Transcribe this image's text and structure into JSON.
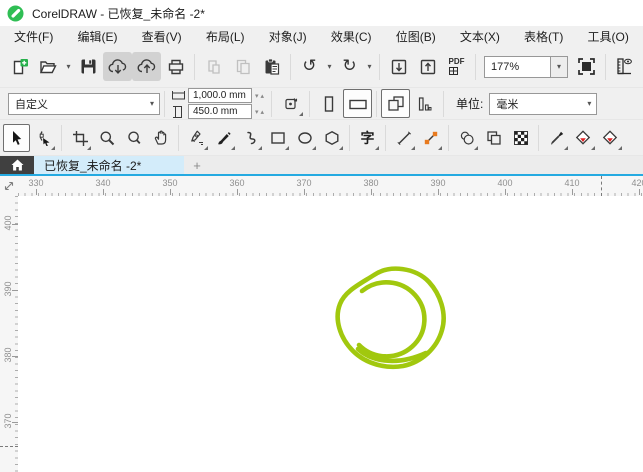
{
  "window": {
    "title": "CorelDRAW - 已恢复_未命名 -2*",
    "app_icon": "coreldraw-logo"
  },
  "menu": {
    "items": [
      {
        "label": "文件(F)"
      },
      {
        "label": "编辑(E)"
      },
      {
        "label": "查看(V)"
      },
      {
        "label": "布局(L)"
      },
      {
        "label": "对象(J)"
      },
      {
        "label": "效果(C)"
      },
      {
        "label": "位图(B)"
      },
      {
        "label": "文本(X)"
      },
      {
        "label": "表格(T)"
      },
      {
        "label": "工具(O)"
      }
    ]
  },
  "standard_toolbar": {
    "zoom_level": "177%",
    "pdf_label": "PDF",
    "icons": [
      "new-document",
      "open",
      "save",
      "cloud-download",
      "cloud-upload",
      "print",
      "cut",
      "copy",
      "paste",
      "undo",
      "redo",
      "import",
      "export",
      "publish-to-pdf",
      "zoom-level-combo",
      "full-screen-preview",
      "show-rulers"
    ],
    "disabled_icons": [
      "cut",
      "copy"
    ],
    "pressed_icons": [
      "cloud-download",
      "cloud-upload"
    ]
  },
  "property_bar": {
    "page_size_preset": "自定义",
    "page_width": "1,000.0 mm",
    "page_height": "450.0 mm",
    "units_label": "单位:",
    "units_value": "毫米",
    "icons": [
      "page-width",
      "page-height",
      "page-dimensions",
      "portrait",
      "landscape",
      "all-pages",
      "current-page"
    ],
    "selected": [
      "landscape",
      "all-pages"
    ]
  },
  "toolbox": {
    "active_tool": "pick",
    "text_tool_glyph": "字",
    "tools": [
      "pick",
      "shape-edit",
      "crop",
      "zoom",
      "zoom-secondary",
      "pan",
      "pen",
      "paint-brush",
      "b-spline",
      "rectangle",
      "ellipse",
      "polygon",
      "text",
      "straight-line",
      "connector",
      "drop-shadow",
      "transparency",
      "pattern-fill",
      "color-eyedropper",
      "interactive-fill",
      "smart-fill"
    ]
  },
  "document_tabs": {
    "active_tab": "已恢复_未命名 -2*",
    "new_tab_label": "+",
    "home_icon": "home"
  },
  "rulers": {
    "unit": "mm",
    "horizontal_labels": [
      "330",
      "340",
      "350",
      "360",
      "370",
      "380",
      "390",
      "400",
      "410",
      "420"
    ],
    "vertical_labels": [
      "400",
      "390",
      "380",
      "370"
    ]
  },
  "canvas": {
    "object": "hand-drawn lime circular scribble",
    "stroke_color": "#a1c80e"
  },
  "colors": {
    "accent_blue": "#25aae1",
    "active_tab_bg": "#d3ecfa",
    "toolbar_bg": "#f0f0f0",
    "lime": "#a1c80e",
    "connector_orange": "#e87a1e",
    "fill_red": "#e02020"
  }
}
